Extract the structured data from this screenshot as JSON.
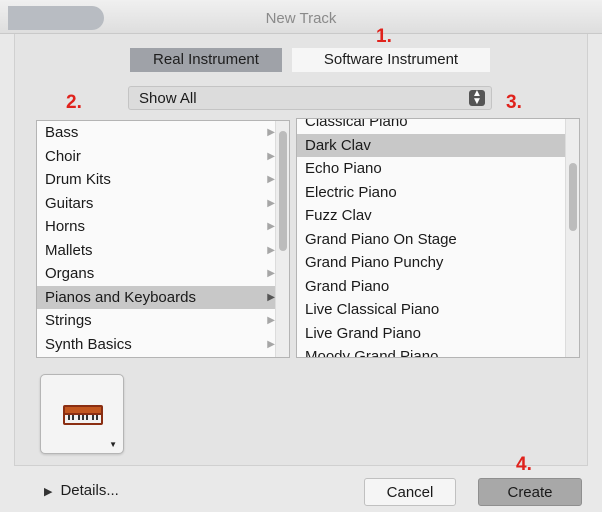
{
  "window": {
    "title": "New Track"
  },
  "segmented": {
    "real": "Real Instrument",
    "software": "Software Instrument"
  },
  "filter": {
    "value": "Show All"
  },
  "annotations": [
    "1.",
    "2.",
    "3.",
    "4."
  ],
  "categories": [
    {
      "label": "Bass"
    },
    {
      "label": "Choir"
    },
    {
      "label": "Drum Kits"
    },
    {
      "label": "Guitars"
    },
    {
      "label": "Horns"
    },
    {
      "label": "Mallets"
    },
    {
      "label": "Organs"
    },
    {
      "label": "Pianos and Keyboards",
      "selected": true
    },
    {
      "label": "Strings"
    },
    {
      "label": "Synth Basics"
    }
  ],
  "presets": [
    {
      "label": "Classical Piano"
    },
    {
      "label": "Dark Clav",
      "selected": true
    },
    {
      "label": "Echo Piano"
    },
    {
      "label": "Electric Piano"
    },
    {
      "label": "Fuzz Clav"
    },
    {
      "label": "Grand Piano On Stage"
    },
    {
      "label": "Grand Piano Punchy"
    },
    {
      "label": "Grand Piano"
    },
    {
      "label": "Live Classical Piano"
    },
    {
      "label": "Live Grand Piano"
    },
    {
      "label": "Moody Grand Piano"
    }
  ],
  "details_label": "Details...",
  "buttons": {
    "cancel": "Cancel",
    "create": "Create"
  },
  "colors": {
    "annotation": "#e0221c",
    "selection": "#c8c8c8"
  },
  "icons": {
    "instrument": "keyboard-icon",
    "disclosure": "disclosure-triangle-icon",
    "popup": "popup-arrows-icon"
  }
}
